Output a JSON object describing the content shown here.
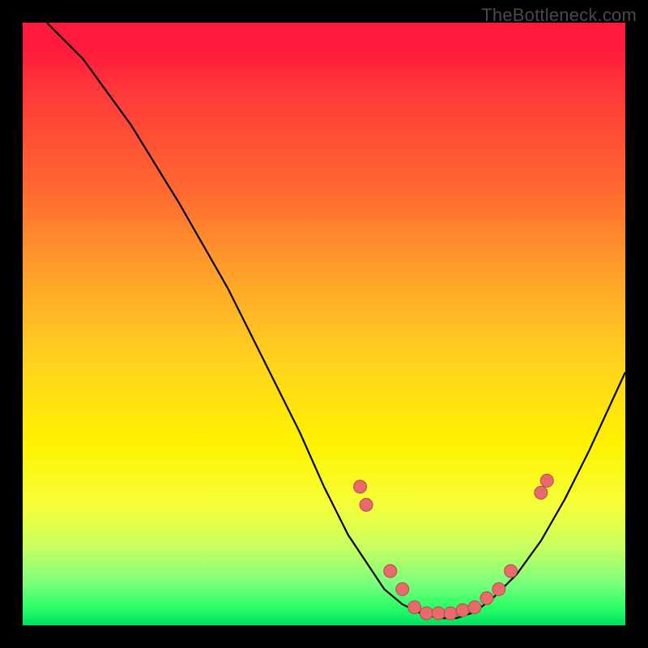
{
  "watermark": "TheBottleneck.com",
  "colors": {
    "dot_fill": "#e86a6a",
    "dot_stroke": "#b54c4c",
    "curve_stroke": "#000000"
  },
  "chart_data": {
    "type": "line",
    "title": "",
    "xlabel": "",
    "ylabel": "",
    "xlim": [
      0,
      100
    ],
    "ylim": [
      0,
      100
    ],
    "grid": false,
    "legend": false,
    "curve": {
      "x": [
        4,
        10,
        18,
        26,
        34,
        40,
        46,
        50,
        54,
        58,
        60,
        63,
        66,
        69,
        72,
        75,
        78,
        82,
        86,
        90,
        94,
        100
      ],
      "y": [
        100,
        94,
        83,
        70,
        56,
        44,
        32,
        23,
        15,
        9,
        6,
        3.5,
        2,
        1.2,
        1.2,
        2.2,
        4.5,
        8.5,
        14,
        21,
        29,
        42
      ]
    },
    "dots": [
      {
        "x": 56,
        "y": 23
      },
      {
        "x": 57,
        "y": 20
      },
      {
        "x": 61,
        "y": 9
      },
      {
        "x": 63,
        "y": 6
      },
      {
        "x": 65,
        "y": 3
      },
      {
        "x": 67,
        "y": 2
      },
      {
        "x": 69,
        "y": 2
      },
      {
        "x": 71,
        "y": 2
      },
      {
        "x": 73,
        "y": 2.5
      },
      {
        "x": 75,
        "y": 3
      },
      {
        "x": 77,
        "y": 4.5
      },
      {
        "x": 79,
        "y": 6
      },
      {
        "x": 81,
        "y": 9
      },
      {
        "x": 86,
        "y": 22
      },
      {
        "x": 87,
        "y": 24
      }
    ]
  }
}
